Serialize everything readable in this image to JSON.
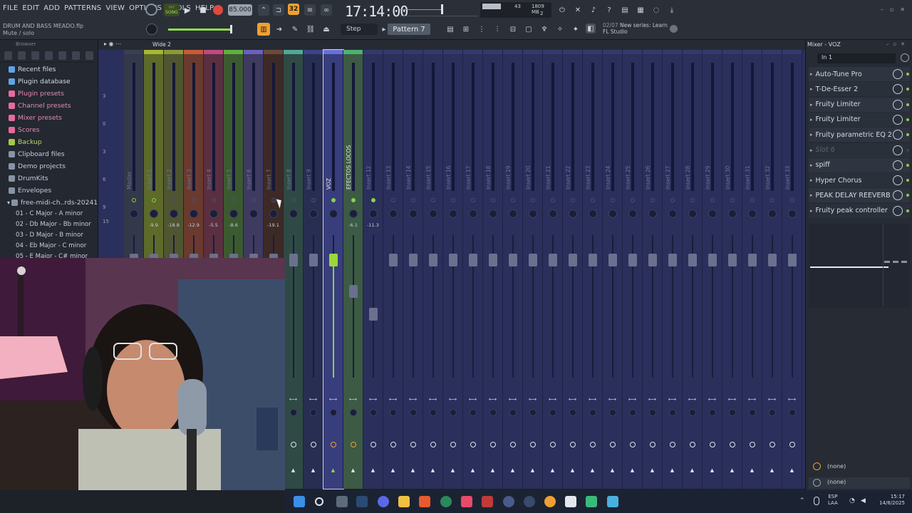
{
  "menu": [
    "FILE",
    "EDIT",
    "ADD",
    "PATTERNS",
    "VIEW",
    "OPTIONS",
    "TOOLS",
    "HELP"
  ],
  "project": {
    "file": "DRUM AND BASS MEADO.flp",
    "hint": "Mute / solo"
  },
  "transport": {
    "mode": "SONG",
    "tempo": "85.000",
    "time": "17:14:00",
    "snap": "Step",
    "pattern": "Pattern 7",
    "memory": "1809 MB",
    "cpu": "43",
    "voices": "2"
  },
  "news": {
    "counter": "02/07",
    "line1": "New series: Learn",
    "line2": "FL Studio"
  },
  "browser": {
    "title": "Browser",
    "items": [
      {
        "label": "Recent files",
        "color": "#5fa4e8"
      },
      {
        "label": "Plugin database",
        "color": "#5fa4e8"
      },
      {
        "label": "Plugin presets",
        "color": "#e86a9a"
      },
      {
        "label": "Channel presets",
        "color": "#e86a9a"
      },
      {
        "label": "Mixer presets",
        "color": "#e86a9a"
      },
      {
        "label": "Scores",
        "color": "#e86a9a"
      },
      {
        "label": "Backup",
        "color": "#a6c84a"
      },
      {
        "label": "Clipboard files",
        "color": "#8894a4"
      },
      {
        "label": "Demo projects",
        "color": "#8894a4"
      },
      {
        "label": "DrumKits",
        "color": "#8894a4"
      },
      {
        "label": "Envelopes",
        "color": "#8894a4"
      },
      {
        "label": "free-midi-ch..rds-20241011",
        "color": "#8894a4"
      },
      {
        "label": "01 - C Major - A minor",
        "color": "#8894a4"
      },
      {
        "label": "02 - Db Major - Bb minor",
        "color": "#8894a4"
      },
      {
        "label": "03 - D Major - B minor",
        "color": "#8894a4"
      },
      {
        "label": "04 - Eb Major - C minor",
        "color": "#8894a4"
      },
      {
        "label": "05 - E Major - C# minor",
        "color": "#8894a4"
      }
    ]
  },
  "mixer": {
    "preset": "Wide 2",
    "db_scale": [
      "3",
      "0",
      "3",
      "6",
      "9",
      "15"
    ],
    "strips": [
      {
        "name": "Master",
        "db": "",
        "color": "#33384a"
      },
      {
        "name": "Insert 1",
        "db": "-9.9",
        "color": "#5d6a2a"
      },
      {
        "name": "Insert 2",
        "db": "-18.8",
        "color": "#4f5530"
      },
      {
        "name": "Insert 3",
        "db": "-12.9",
        "color": "#6a3a2e"
      },
      {
        "name": "Insert 4",
        "db": "-5.5",
        "color": "#5a3040"
      },
      {
        "name": "Insert 5",
        "db": "-8.6",
        "color": "#3c5a30"
      },
      {
        "name": "Insert 6",
        "db": "",
        "color": "#3e3a60"
      },
      {
        "name": "Insert 7",
        "db": "-19.1",
        "color": "#3d2a26"
      },
      {
        "name": "Insert 8",
        "db": "",
        "color": "#2f4a45"
      },
      {
        "name": "Insert 9",
        "db": "",
        "color": "#282e52"
      },
      {
        "name": "VOZ",
        "db": "",
        "color": "#383e7c"
      },
      {
        "name": "EFECTOS LOCOS",
        "db": "-6.1",
        "color": "#3c5a44"
      },
      {
        "name": "Insert 12",
        "db": "-11.3",
        "color": "#2a2f5b"
      },
      {
        "name": "Insert 13",
        "db": "",
        "color": "#2a2f5b"
      },
      {
        "name": "Insert 14",
        "db": "",
        "color": "#2a2f5b"
      },
      {
        "name": "Insert 15",
        "db": "",
        "color": "#2a2f5b"
      },
      {
        "name": "Insert 16",
        "db": "",
        "color": "#2a2f5b"
      },
      {
        "name": "Insert 17",
        "db": "",
        "color": "#2a2f5b"
      },
      {
        "name": "Insert 18",
        "db": "",
        "color": "#2a2f5b"
      },
      {
        "name": "Insert 19",
        "db": "",
        "color": "#2a2f5b"
      },
      {
        "name": "Insert 20",
        "db": "",
        "color": "#2a2f5b"
      },
      {
        "name": "Insert 21",
        "db": "",
        "color": "#2a2f5b"
      },
      {
        "name": "Insert 22",
        "db": "",
        "color": "#2a2f5b"
      },
      {
        "name": "Insert 23",
        "db": "",
        "color": "#2a2f5b"
      },
      {
        "name": "Insert 24",
        "db": "",
        "color": "#2a2f5b"
      },
      {
        "name": "Insert 25",
        "db": "",
        "color": "#2a2f5b"
      },
      {
        "name": "Insert 26",
        "db": "",
        "color": "#2a2f5b"
      },
      {
        "name": "Insert 27",
        "db": "",
        "color": "#2a2f5b"
      },
      {
        "name": "Insert 28",
        "db": "",
        "color": "#2a2f5b"
      },
      {
        "name": "Insert 29",
        "db": "",
        "color": "#2a2f5b"
      },
      {
        "name": "Insert 30",
        "db": "",
        "color": "#2a2f5b"
      },
      {
        "name": "Insert 31",
        "db": "",
        "color": "#2a2f5b"
      },
      {
        "name": "Insert 32",
        "db": "",
        "color": "#2a2f5b"
      },
      {
        "name": "Insert 33",
        "db": "",
        "color": "#2a2f5b"
      }
    ]
  },
  "track_panel": {
    "title": "Mixer - VOZ",
    "input": "In 1",
    "slots": [
      {
        "label": "Auto-Tune Pro",
        "active": true
      },
      {
        "label": "T-De-Esser 2",
        "active": true
      },
      {
        "label": "Fruity Limiter",
        "active": true
      },
      {
        "label": "Fruity Limiter",
        "active": true
      },
      {
        "label": "Fruity parametric EQ 2",
        "active": true
      },
      {
        "label": "Slot 6",
        "active": false
      },
      {
        "label": "spiff",
        "active": true
      },
      {
        "label": "Hyper Chorus",
        "active": true
      },
      {
        "label": "PEAK DELAY REEVERB",
        "active": true
      },
      {
        "label": "Fruity peak controller",
        "active": true
      }
    ],
    "out1": "(none)",
    "out2": "(none)"
  },
  "taskbar": {
    "lang1": "ESP",
    "lang2": "LAA",
    "time": "15:17",
    "date": "14/8/2025"
  }
}
